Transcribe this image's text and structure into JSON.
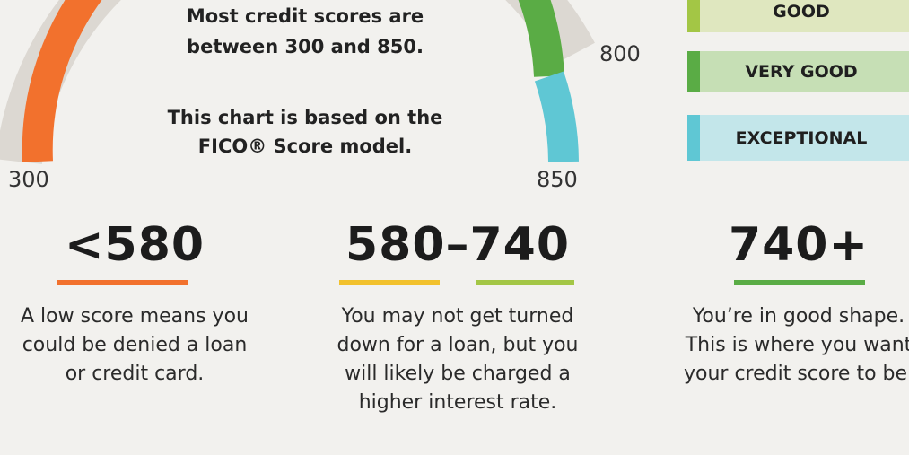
{
  "gauge": {
    "scale_min": "300",
    "scale_800": "800",
    "scale_max": "850",
    "colors": {
      "poor": "#f2712d",
      "good_green": "#5aac45",
      "exceptional": "#5fc7d4",
      "track": "#dcd8d2"
    },
    "info_line1": "Most credit scores are",
    "info_line2": "between 300 and 850.",
    "info_line3": "This chart is based on the",
    "info_line4": "FICO® Score model."
  },
  "legend": [
    {
      "label": "GOOD",
      "stripe_color": "#a3c645",
      "bg_color": "#dfe7bf"
    },
    {
      "label": "VERY GOOD",
      "stripe_color": "#5aac45",
      "bg_color": "#c6dfb5"
    },
    {
      "label": "EXCEPTIONAL",
      "stripe_color": "#5fc7d4",
      "bg_color": "#c3e6ea"
    }
  ],
  "ranges": [
    {
      "value": "<580",
      "underline_colors": [
        "#f2712d"
      ],
      "desc_lines": [
        "A low score means you",
        "could be denied a loan",
        "or credit card."
      ]
    },
    {
      "value": "580–740",
      "underline_colors": [
        "#f2c12d",
        "#a3c645"
      ],
      "desc_lines": [
        "You may not get turned",
        "down for a loan, but you",
        "will likely be charged a",
        "higher interest rate."
      ]
    },
    {
      "value": "740+",
      "underline_colors": [
        "#5aac45"
      ],
      "desc_lines": [
        "You’re in good shape.",
        "This is where you want",
        "your credit score to be."
      ]
    }
  ]
}
